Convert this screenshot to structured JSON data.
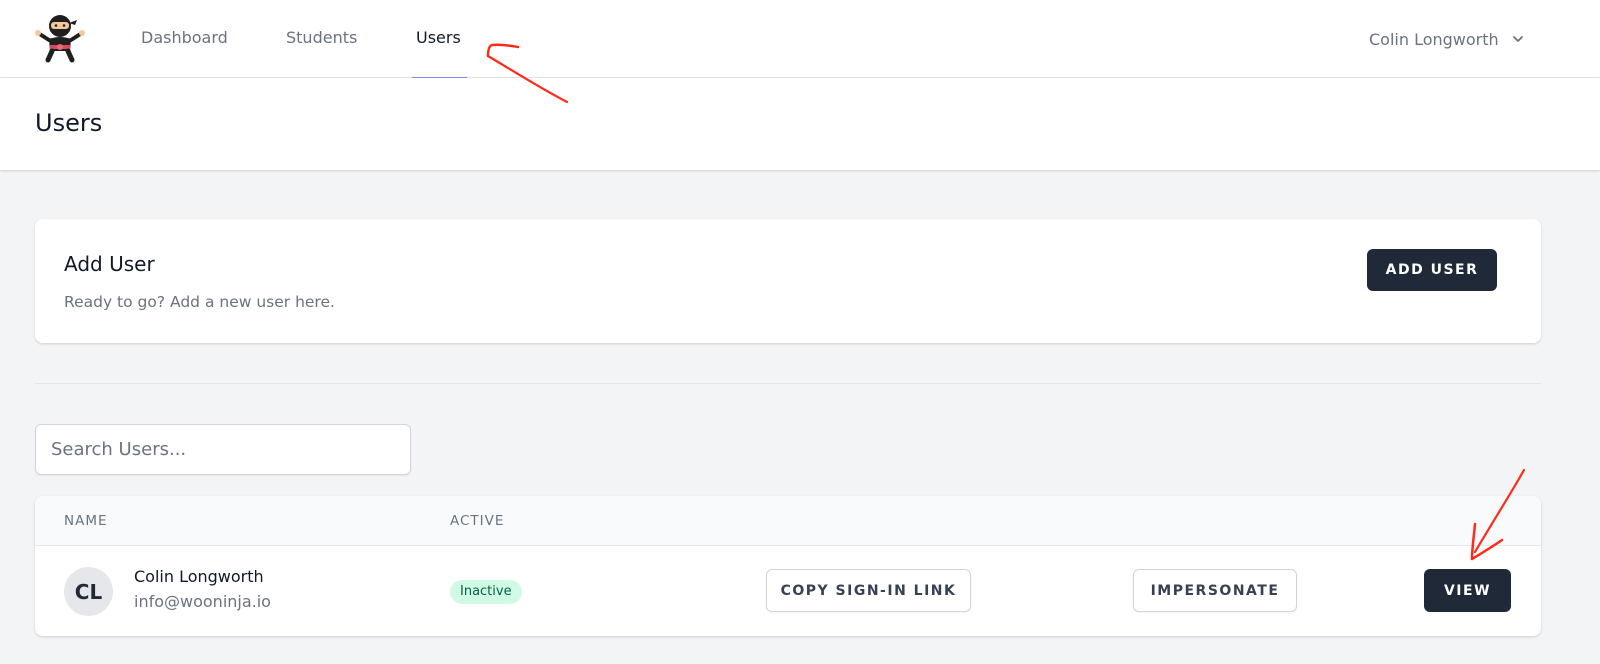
{
  "nav": {
    "links": [
      {
        "label": "Dashboard",
        "active": false
      },
      {
        "label": "Students",
        "active": false
      },
      {
        "label": "Users",
        "active": true
      }
    ],
    "user_name": "Colin Longworth",
    "logo_icon": "ninja-logo-icon",
    "dropdown_icon": "chevron-down-icon"
  },
  "page": {
    "title": "Users"
  },
  "add_user": {
    "title": "Add User",
    "description": "Ready to go? Add a new user here.",
    "button_label": "Add User"
  },
  "search": {
    "placeholder": "Search Users...",
    "value": ""
  },
  "table": {
    "headers": [
      "Name",
      "Active"
    ],
    "rows": [
      {
        "initials": "CL",
        "name": "Colin Longworth",
        "email": "info@wooninja.io",
        "status": "Inactive",
        "copy_label": "Copy Sign-in Link",
        "impersonate_label": "Impersonate",
        "view_label": "View"
      }
    ]
  },
  "colors": {
    "annotation": "#ff2a1a",
    "primary_button": "#1f2937",
    "active_tab_underline": "#818cf8",
    "badge_bg": "#d1fae5",
    "badge_text": "#065f46"
  }
}
